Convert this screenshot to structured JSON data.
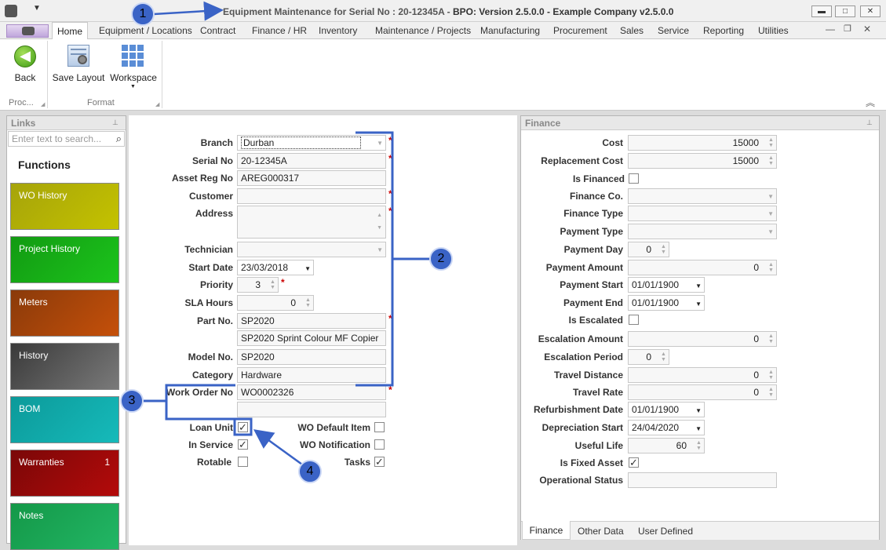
{
  "window": {
    "title": "Equipment Maintenance for Serial No : 20-12345A - BPO: Version 2.5.0.0 - Example Company v2.5.0.0",
    "title_part1": "Equipment Maintenance for Serial No : 20-12345A - ",
    "title_part2": "BPO: Version 2.5.0.0 - Example Company v2.5.0.0"
  },
  "menu": {
    "tabs": [
      "Home",
      "Equipment / Locations",
      "Contract",
      "Finance / HR",
      "Inventory",
      "Maintenance / Projects",
      "Manufacturing",
      "Procurement",
      "Sales",
      "Service",
      "Reporting",
      "Utilities"
    ]
  },
  "ribbon": {
    "back_label": "Back",
    "save_layout_label": "Save Layout",
    "workspace_label": "Workspace",
    "group_process": "Proc...",
    "group_format": "Format"
  },
  "links_panel": {
    "title": "Links",
    "search_placeholder": "Enter text to search...",
    "functions_heading": "Functions",
    "tiles": [
      {
        "label": "WO History",
        "badge": "",
        "color": "#b4b400"
      },
      {
        "label": "Project History",
        "badge": "",
        "color": "#16b316"
      },
      {
        "label": "Meters",
        "badge": "",
        "color": "#b54b10"
      },
      {
        "label": "History",
        "badge": "",
        "color": "#5a5a5a"
      },
      {
        "label": "BOM",
        "badge": "",
        "color": "#12a8a8"
      },
      {
        "label": "Warranties",
        "badge": "1",
        "color": "#a00a0a"
      },
      {
        "label": "Notes",
        "badge": "",
        "color": "#1fa85a"
      }
    ]
  },
  "main_form": {
    "branch": {
      "label": "Branch",
      "value": "Durban"
    },
    "serial_no": {
      "label": "Serial No",
      "value": "20-12345A"
    },
    "asset_reg_no": {
      "label": "Asset Reg No",
      "value": "AREG000317"
    },
    "customer": {
      "label": "Customer",
      "value": ""
    },
    "address": {
      "label": "Address",
      "value": ""
    },
    "technician": {
      "label": "Technician",
      "value": ""
    },
    "start_date": {
      "label": "Start Date",
      "value": "23/03/2018"
    },
    "priority": {
      "label": "Priority",
      "value": "3"
    },
    "sla_hours": {
      "label": "SLA Hours",
      "value": "0"
    },
    "part_no": {
      "label": "Part No.",
      "value": "SP2020",
      "description": "SP2020 Sprint Colour MF Copier"
    },
    "model_no": {
      "label": "Model No.",
      "value": "SP2020"
    },
    "category": {
      "label": "Category",
      "value": "Hardware"
    },
    "work_order_no": {
      "label": "Work Order No",
      "value": "WO0002326"
    },
    "required_marker": "*",
    "checkboxes": {
      "loan_unit": {
        "label": "Loan Unit",
        "checked": true
      },
      "in_service": {
        "label": "In Service",
        "checked": true
      },
      "rotable": {
        "label": "Rotable",
        "checked": false
      },
      "wo_default_item": {
        "label": "WO Default Item",
        "checked": false
      },
      "wo_notification": {
        "label": "WO Notification",
        "checked": false
      },
      "tasks": {
        "label": "Tasks",
        "checked": true
      }
    }
  },
  "finance_panel": {
    "title": "Finance",
    "cost": {
      "label": "Cost",
      "value": "15000"
    },
    "replacement_cost": {
      "label": "Replacement Cost",
      "value": "15000"
    },
    "is_financed": {
      "label": "Is Financed",
      "checked": false
    },
    "finance_co": {
      "label": "Finance Co.",
      "value": ""
    },
    "finance_type": {
      "label": "Finance Type",
      "value": ""
    },
    "payment_type": {
      "label": "Payment Type",
      "value": ""
    },
    "payment_day": {
      "label": "Payment Day",
      "value": "0"
    },
    "payment_amount": {
      "label": "Payment Amount",
      "value": "0"
    },
    "payment_start": {
      "label": "Payment Start",
      "value": "01/01/1900"
    },
    "payment_end": {
      "label": "Payment End",
      "value": "01/01/1900"
    },
    "is_escalated": {
      "label": "Is Escalated",
      "checked": false
    },
    "escalation_amount": {
      "label": "Escalation Amount",
      "value": "0"
    },
    "escalation_period": {
      "label": "Escalation Period",
      "value": "0"
    },
    "travel_distance": {
      "label": "Travel Distance",
      "value": "0"
    },
    "travel_rate": {
      "label": "Travel Rate",
      "value": "0"
    },
    "refurbishment_date": {
      "label": "Refurbishment Date",
      "value": "01/01/1900"
    },
    "depreciation_start": {
      "label": "Depreciation Start",
      "value": "24/04/2020"
    },
    "useful_life": {
      "label": "Useful Life",
      "value": "60"
    },
    "is_fixed_asset": {
      "label": "Is Fixed Asset",
      "checked": true
    },
    "operational_status": {
      "label": "Operational Status",
      "value": ""
    },
    "bottom_tabs": [
      "Finance",
      "Other Data",
      "User Defined"
    ]
  },
  "callouts": [
    "1",
    "2",
    "3",
    "4"
  ],
  "colors": {
    "accent": "#3a63c6",
    "required": "#cc0000"
  }
}
